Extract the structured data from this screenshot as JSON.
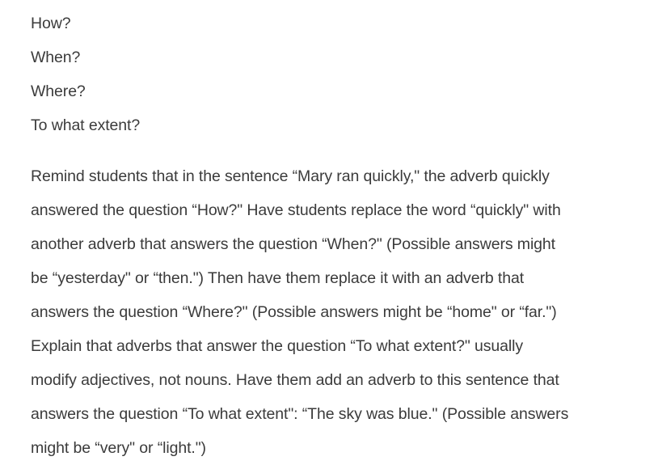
{
  "questions": [
    "How?",
    "When?",
    "Where?",
    "To what extent?"
  ],
  "paragraph_lines": [
    "Remind students that in the sentence “Mary ran quickly,\" the adverb quickly",
    "answered the question “How?\" Have students replace the word “quickly\" with",
    "another adverb that answers the question “When?\" (Possible answers might",
    "be “yesterday\" or “then.\") Then have them replace it with an adverb that",
    "answers the question “Where?\" (Possible answers might be “home\" or “far.\")",
    "Explain that adverbs that answer the question “To what extent?\" usually",
    "modify adjectives, not nouns. Have them add an adverb to this sentence that",
    "answers the question “To what extent\": “The sky was blue.\" (Possible answers",
    "might be “very\" or “light.\")"
  ]
}
